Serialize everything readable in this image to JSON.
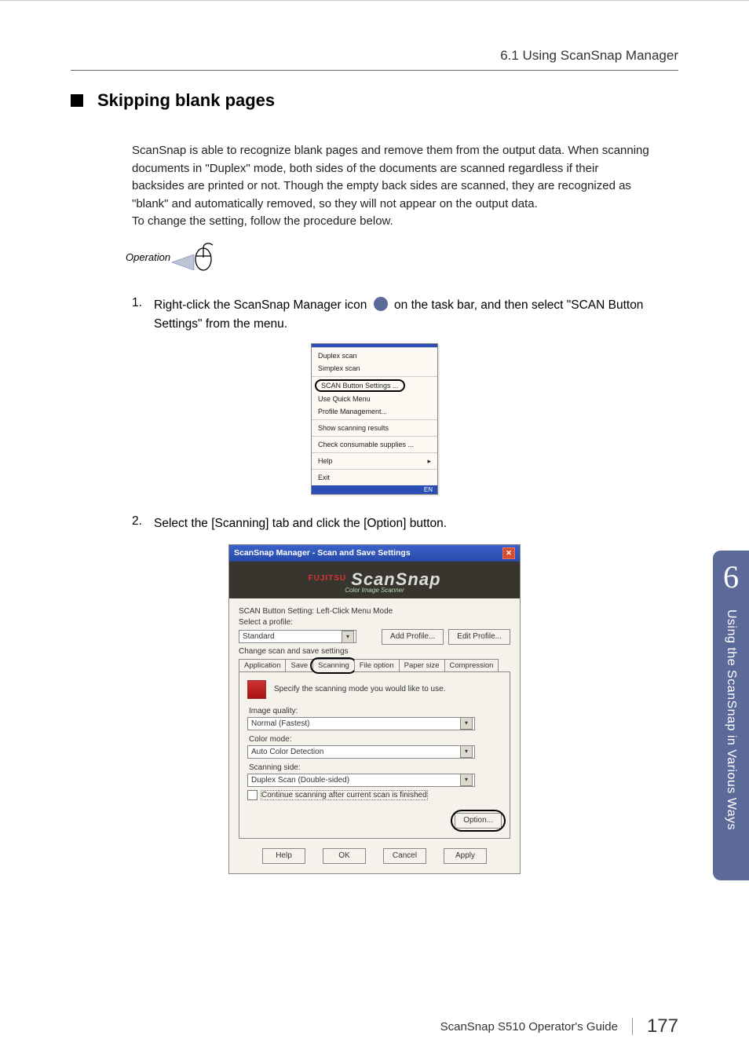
{
  "header": {
    "breadcrumb": "6.1 Using ScanSnap Manager"
  },
  "section": {
    "title": "Skipping blank pages"
  },
  "paragraph": {
    "l1": "ScanSnap is able to recognize blank pages and remove them from the output data. When scanning",
    "l2": "documents in \"Duplex\" mode, both sides of the documents are scanned regardless if their",
    "l3": "backsides are printed or not. Though the empty back sides are scanned, they are recognized as",
    "l4": "\"blank\" and automatically removed, so they will not appear on the output data.",
    "l5": "To change the setting, follow the procedure below."
  },
  "operation_label": "Operation",
  "step1": {
    "num": "1.",
    "pre": "Right-click the ScanSnap Manager icon ",
    "post": " on the task bar, and then select \"SCAN Button Settings\" from the menu."
  },
  "context_menu": {
    "items_a": [
      "Duplex scan",
      "Simplex scan"
    ],
    "selected": "SCAN Button Settings ...",
    "items_b": [
      "Use Quick Menu",
      "Profile Management..."
    ],
    "items_c": [
      "Show scanning results"
    ],
    "items_d": [
      "Check consumable supplies ..."
    ],
    "items_e": [
      "Help"
    ],
    "items_f": [
      "Exit"
    ],
    "tray": "EN"
  },
  "step2": {
    "num": "2.",
    "text": "Select the [Scanning] tab and click the [Option] button."
  },
  "dialog": {
    "title": "ScanSnap Manager - Scan and Save Settings",
    "brand": "FUJITSU",
    "banner_main": "ScanSnap",
    "banner_sub": "Color Image Scanner",
    "mode_line": "SCAN Button Setting: Left-Click Menu Mode",
    "select_profile": "Select a profile:",
    "profile_value": "Standard",
    "add_profile": "Add Profile...",
    "edit_profile": "Edit Profile...",
    "change_line": "Change scan and save settings",
    "tabs": [
      "Application",
      "Save",
      "Scanning",
      "File option",
      "Paper size",
      "Compression"
    ],
    "specify": "Specify the scanning mode you would like to use.",
    "image_quality_label": "Image quality:",
    "image_quality_value": "Normal (Fastest)",
    "color_mode_label": "Color mode:",
    "color_mode_value": "Auto Color Detection",
    "scanning_side_label": "Scanning side:",
    "scanning_side_value": "Duplex Scan (Double-sided)",
    "continue_cb": "Continue scanning after current scan is finished",
    "option_btn": "Option...",
    "help": "Help",
    "ok": "OK",
    "cancel": "Cancel",
    "apply": "Apply"
  },
  "sidetab": {
    "chapter": "6",
    "text": "Using the ScanSnap in Various Ways"
  },
  "footer": {
    "guide": "ScanSnap S510 Operator's Guide",
    "page": "177"
  }
}
